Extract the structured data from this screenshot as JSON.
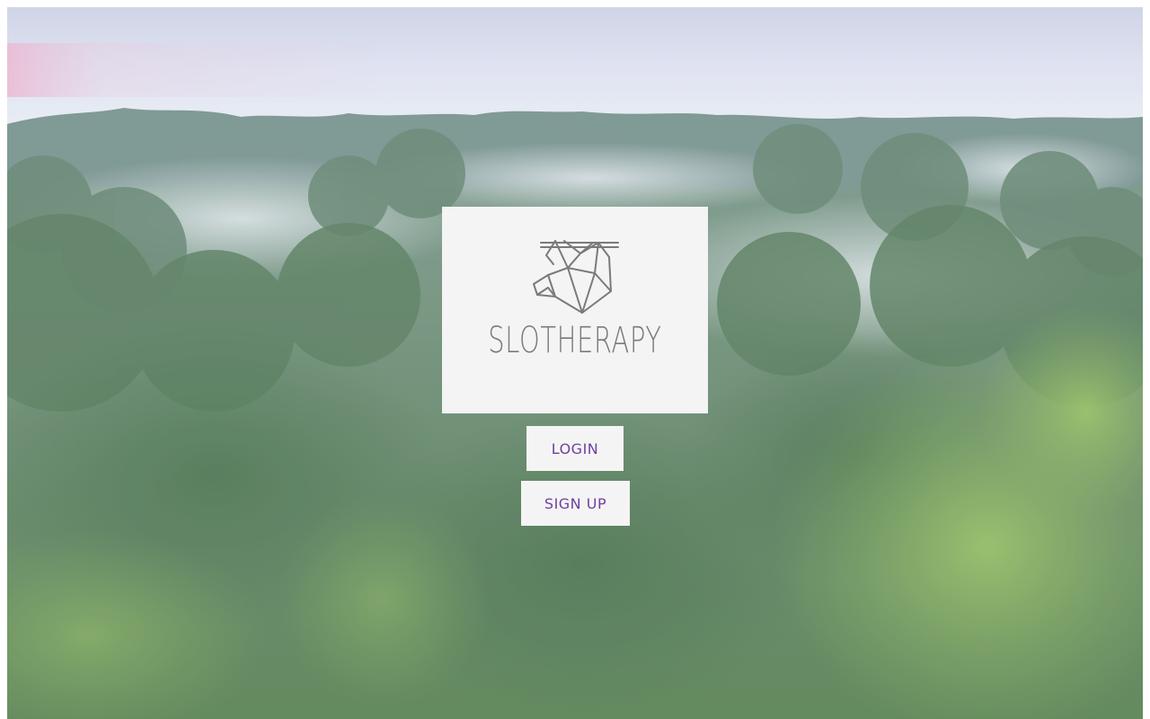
{
  "brand": {
    "name": "SLOTHERAPY",
    "logo_icon": "sloth-geometric-icon",
    "text_color": "#7a7a7a"
  },
  "actions": {
    "login_label": "LOGIN",
    "signup_label": "SIGN UP",
    "button_text_color": "#6f3fa0"
  },
  "background": {
    "description_icon": "rainforest-canopy-background"
  }
}
